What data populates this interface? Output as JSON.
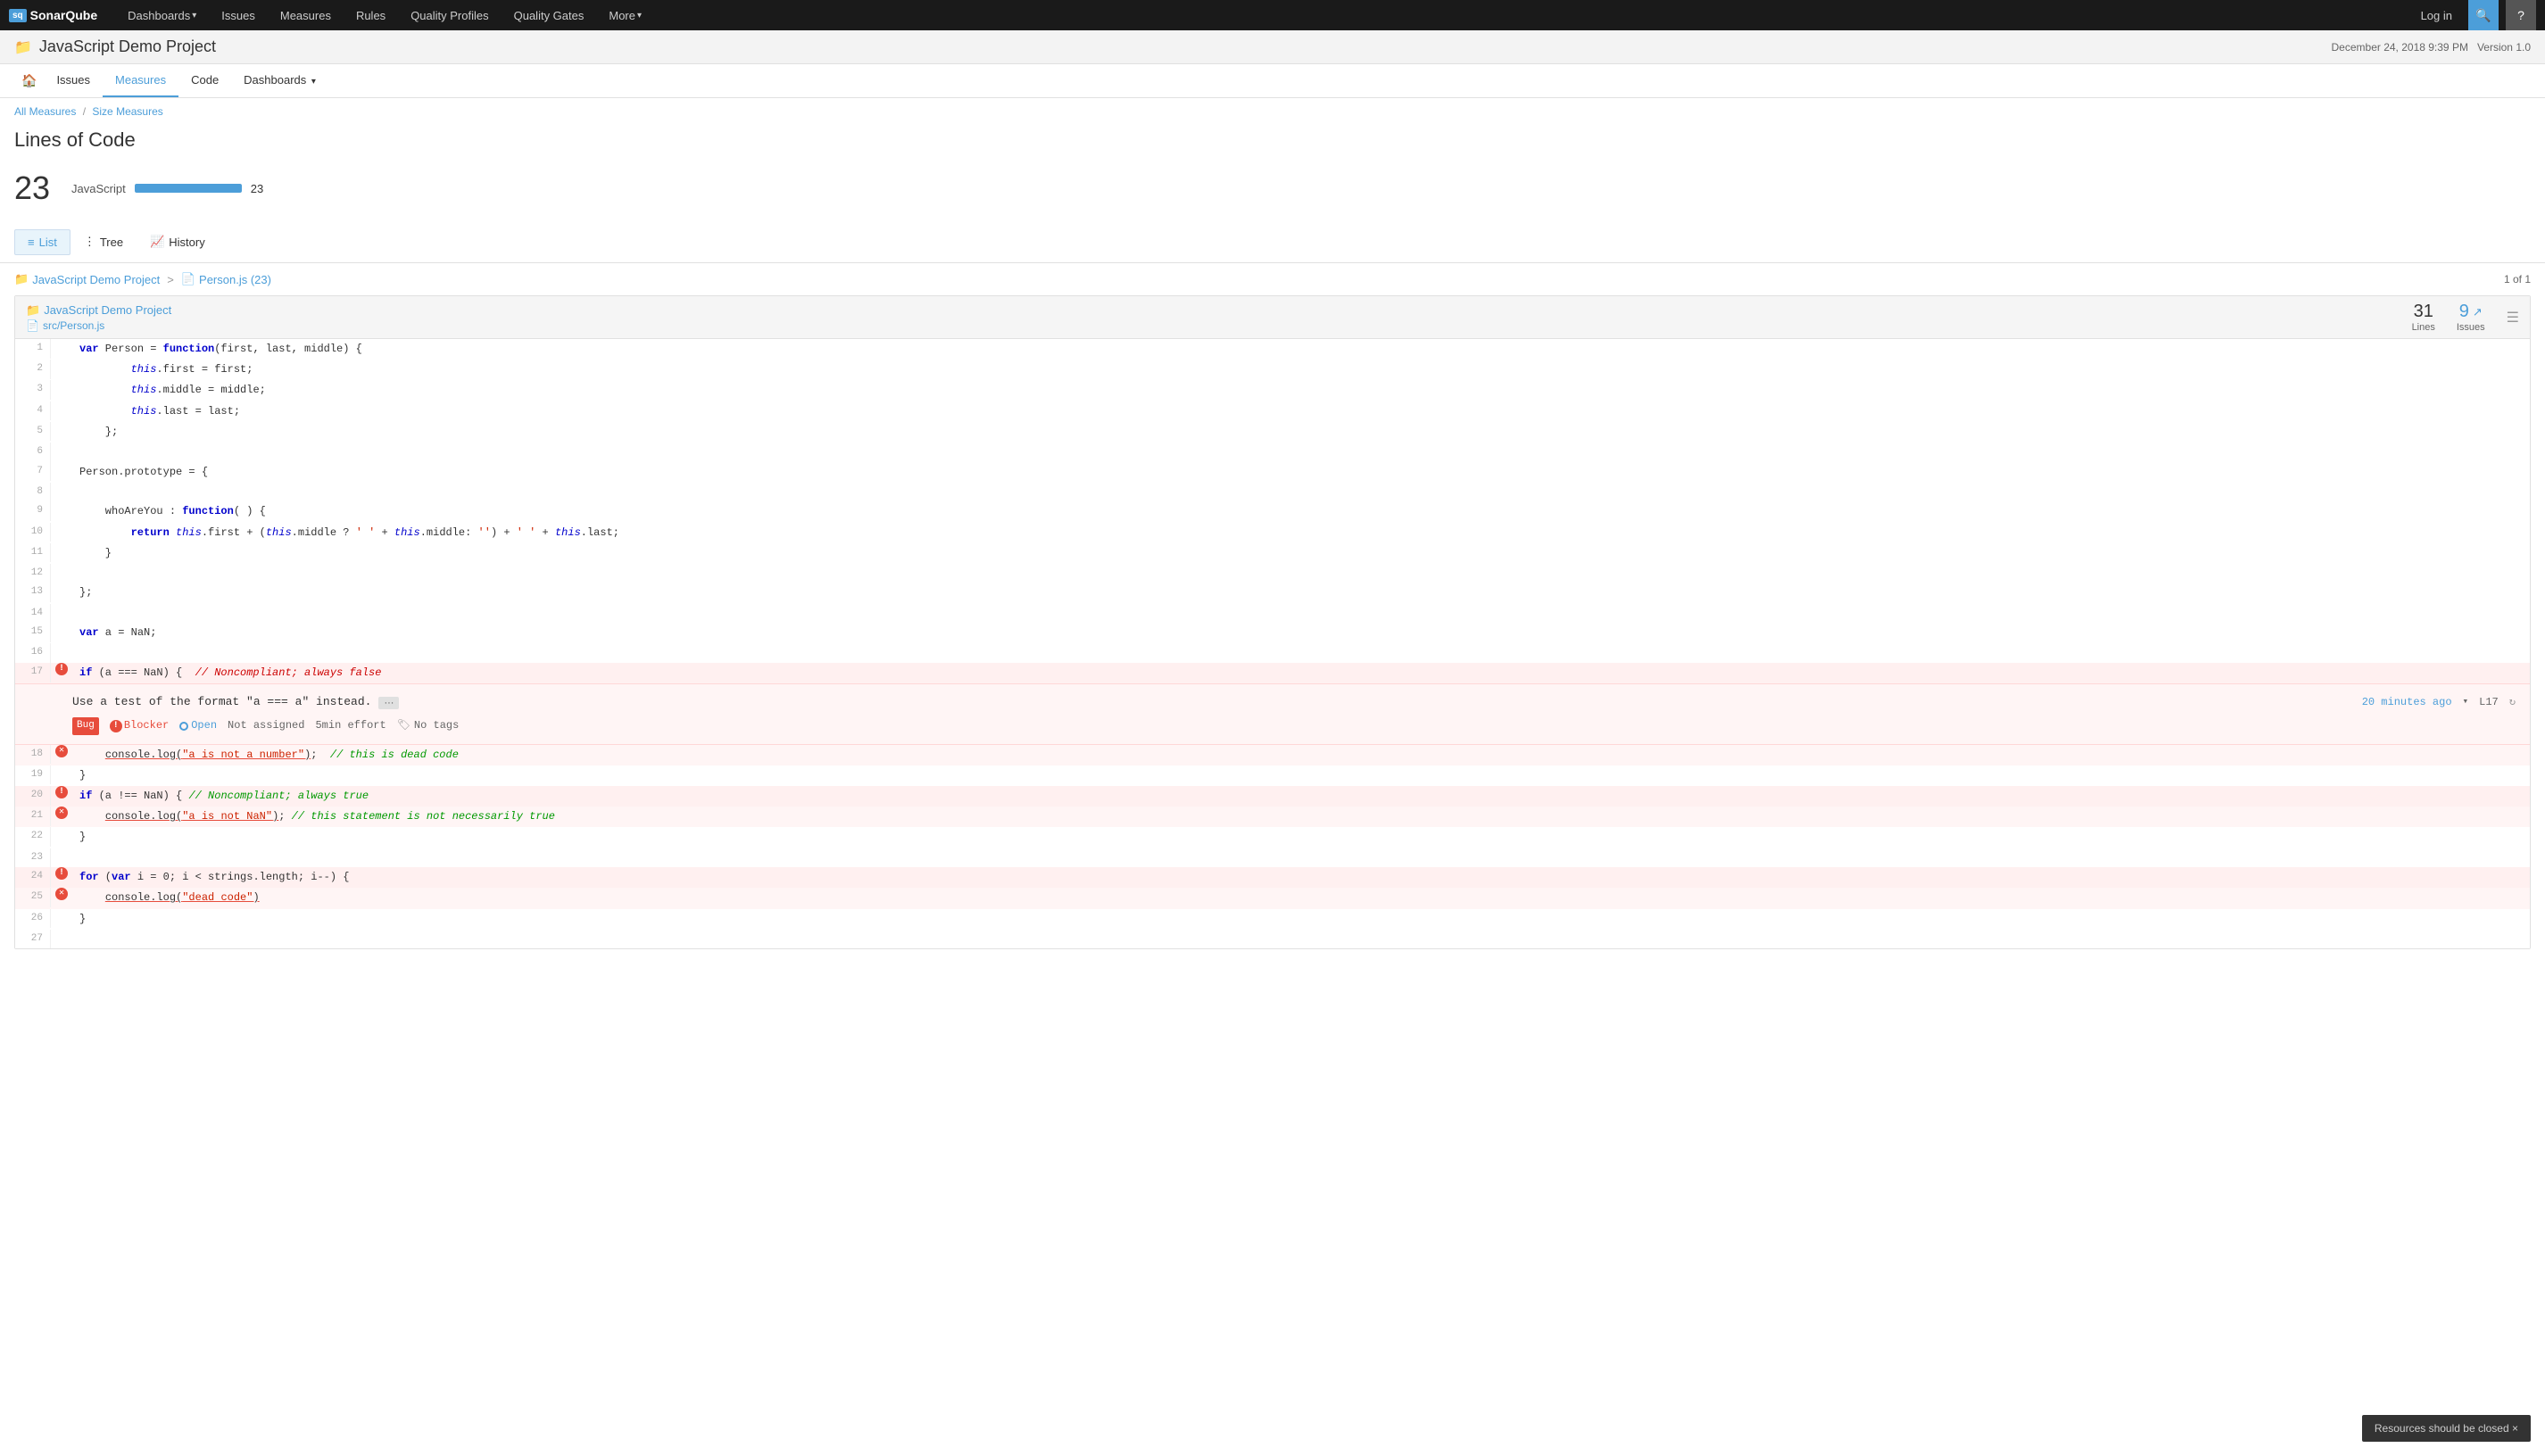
{
  "topNav": {
    "logo": "SonarQube",
    "items": [
      "Dashboards",
      "Issues",
      "Measures",
      "Rules",
      "Quality Profiles",
      "Quality Gates",
      "More"
    ],
    "login": "Log in",
    "searchLabel": "🔍",
    "helpLabel": "?"
  },
  "projectHeader": {
    "icon": "📁",
    "title": "JavaScript Demo Project",
    "date": "December 24, 2018 9:39 PM",
    "version": "Version 1.0"
  },
  "subNav": {
    "home": "🏠",
    "items": [
      "Issues",
      "Measures",
      "Code",
      "Dashboards"
    ]
  },
  "breadcrumb": {
    "allMeasures": "All Measures",
    "separator": "/",
    "sizeMeasures": "Size Measures"
  },
  "pageTitle": "Lines of Code",
  "metrics": {
    "total": "23",
    "breakdown": [
      {
        "label": "JavaScript",
        "value": 23,
        "barWidth": 100
      }
    ]
  },
  "viewTabs": [
    {
      "id": "list",
      "icon": "≡",
      "label": "List",
      "active": true
    },
    {
      "id": "tree",
      "icon": "⋮",
      "label": "Tree",
      "active": false
    },
    {
      "id": "history",
      "icon": "📈",
      "label": "History",
      "active": false
    }
  ],
  "fileNav": {
    "project": "JavaScript Demo Project",
    "file": "Person.js (23)",
    "count": "1 of 1"
  },
  "codeFile": {
    "projectName": "JavaScript Demo Project",
    "fileName": "src/Person.js",
    "lines": 31,
    "linesLabel": "Lines",
    "issues": 9,
    "issuesLabel": "Issues"
  },
  "toast": {
    "text": "Resources should be closed ×"
  },
  "issue1": {
    "message": "Use a test of the format \"a === a\" instead.",
    "time": "20 minutes ago",
    "location": "L17",
    "type": "Bug",
    "severity": "Blocker",
    "status": "Open",
    "assigned": "Not assigned",
    "effort": "5min effort",
    "tags": "No tags"
  }
}
